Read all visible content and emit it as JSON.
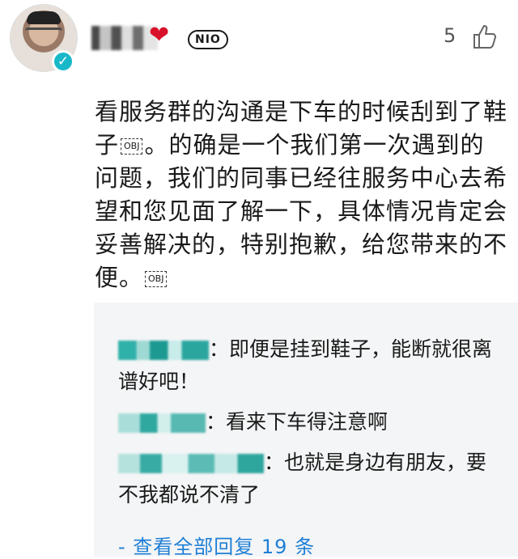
{
  "comment": {
    "nio_badge": "NIO",
    "like_count": "5",
    "text_part1": "看服务群的沟通是下车的时候刮到了鞋子",
    "obj_marker": "OBJ",
    "text_part2": "。的确是一个我们第一次遇到的问题，我们的同事已经往服务中心去希望和您见面了解一下，具体情况肯定会妥善解决的，特别抱歉，给您带来的不便。"
  },
  "replies": [
    {
      "text": "：即便是挂到鞋子，能断就很离谱好吧！"
    },
    {
      "text": "：看来下车得注意啊"
    },
    {
      "text": "：也就是身边有朋友，要不我都说不清了"
    }
  ],
  "view_all_replies": "- 查看全部回复 19 条",
  "colors": {
    "link": "#1f7fd6",
    "badge": "#18b8c8",
    "reply_bg": "#f4f5f6"
  },
  "icons": {
    "like": "thumbs-up-icon",
    "verified": "verified-icon",
    "heart": "heart-icon"
  }
}
